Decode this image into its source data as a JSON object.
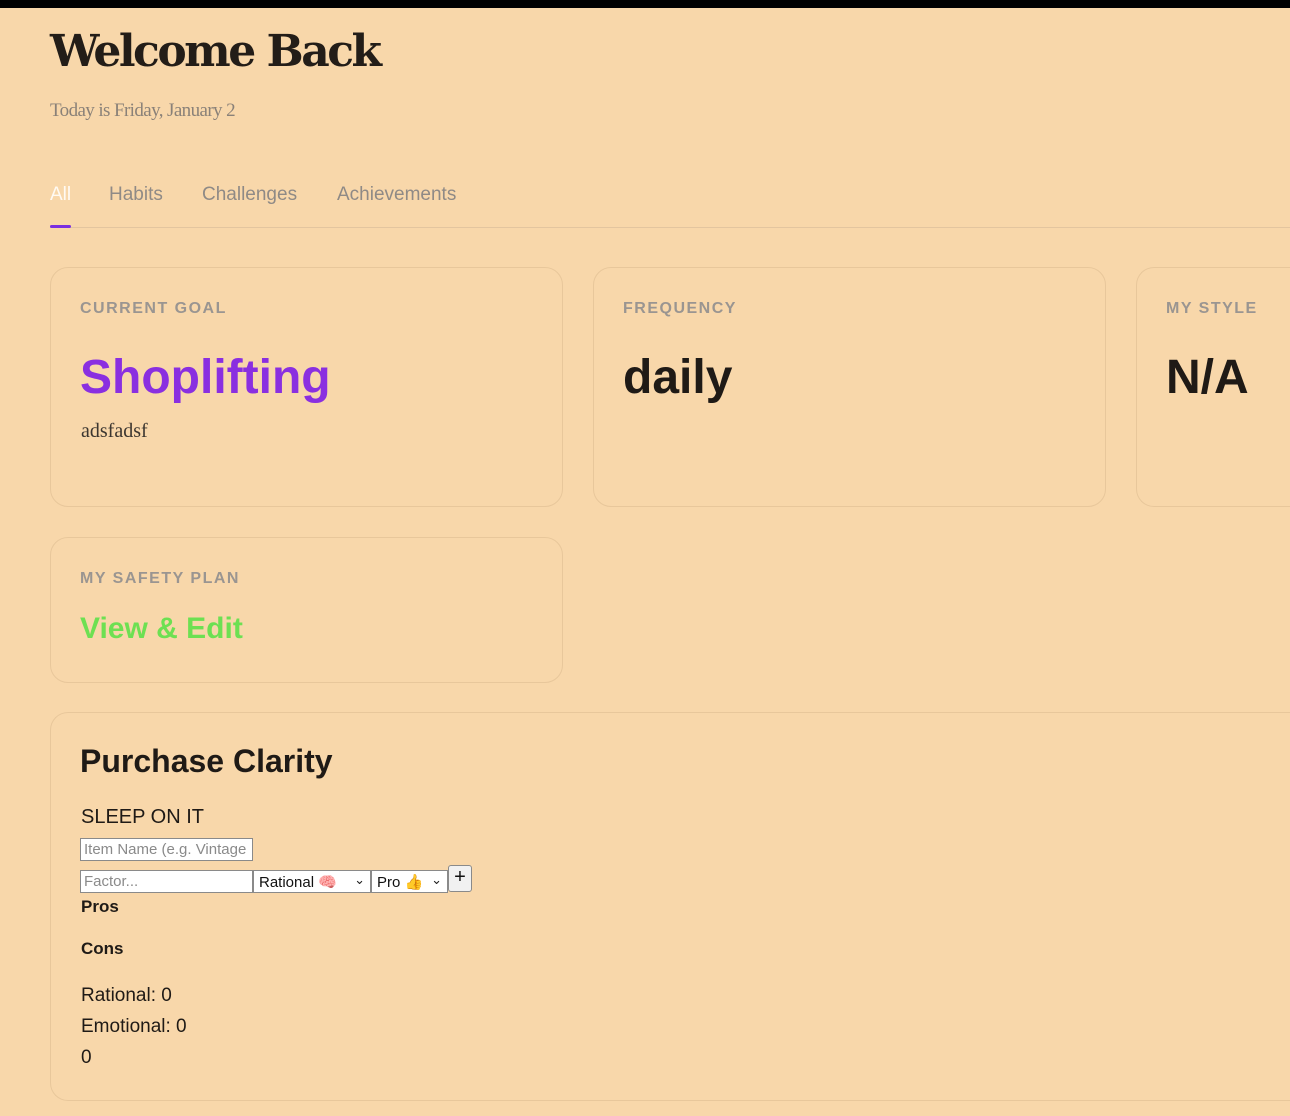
{
  "header": {
    "title": "Welcome Back",
    "subtitle": "Today is Friday, January 2"
  },
  "tabs": [
    {
      "label": "All",
      "active": true
    },
    {
      "label": "Habits",
      "active": false
    },
    {
      "label": "Challenges",
      "active": false
    },
    {
      "label": "Achievements",
      "active": false
    }
  ],
  "cards": {
    "current_goal": {
      "label": "CURRENT GOAL",
      "value": "Shoplifting",
      "description": "adsfadsf"
    },
    "frequency": {
      "label": "FREQUENCY",
      "value": "daily"
    },
    "my_style": {
      "label": "MY STYLE",
      "value": "N/A"
    },
    "safety_plan": {
      "label": "MY SAFETY PLAN",
      "link": "View & Edit"
    }
  },
  "purchase_clarity": {
    "title": "Purchase Clarity",
    "subtitle": "SLEEP ON IT",
    "item_placeholder": "Item Name (e.g. Vintage",
    "factor_placeholder": "Factor...",
    "type_select": "Rational 🧠",
    "side_select": "Pro 👍",
    "add_label": "+",
    "pros_label": "Pros",
    "cons_label": "Cons",
    "rational": "Rational: 0",
    "emotional": "Emotional: 0",
    "score": "0"
  },
  "colors": {
    "background": "#f8d7aa",
    "accent": "#8a2fe0",
    "link": "#6de052"
  },
  "icons": {
    "add": "plus-icon",
    "dropdown": "chevron-down-icon"
  }
}
